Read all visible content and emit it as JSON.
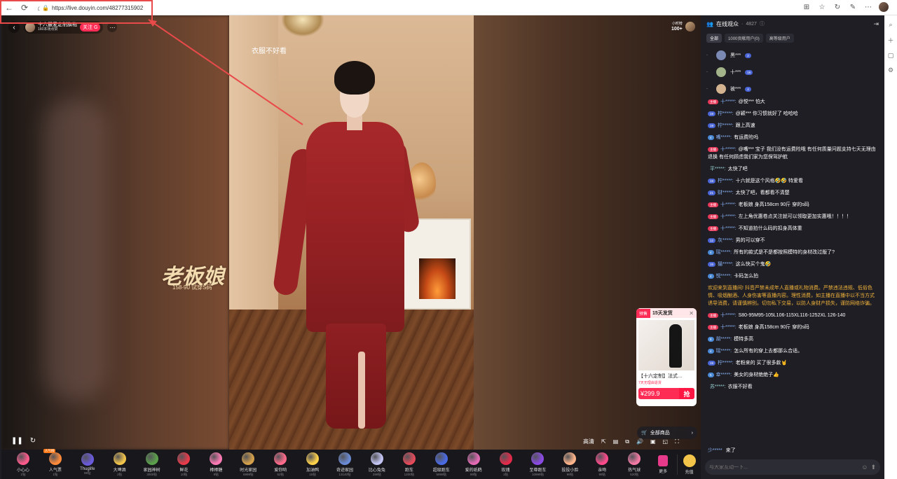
{
  "browser": {
    "url": "https://live.douyin.com/48277315902"
  },
  "video": {
    "caption": "衣服不好看",
    "watermark_main": "老板娘",
    "watermark_sub": "158-90 试穿S码"
  },
  "streamer": {
    "name": "十六最爱定制旗袍",
    "likes": "160本场点赞",
    "follow_label": "关注",
    "follow_badge": "G"
  },
  "rank": {
    "label": "小时榜",
    "value": "100+"
  },
  "product": {
    "tag": "预售",
    "ship": "15天发货",
    "title": "【十六定制】法式…",
    "sub": "7天无理由退货",
    "price": "¥299.9",
    "grab": "抢",
    "all_goods": "全部商品"
  },
  "controls": {
    "quality": "高清"
  },
  "gifts": [
    {
      "name": "小心心",
      "price": "1钻",
      "color": "#ff5a8c",
      "badge": ""
    },
    {
      "name": "人气票",
      "price": "1钻",
      "color": "#ff8a3a",
      "badge": "人气榜"
    },
    {
      "name": "Thuglife",
      "price": "99钻",
      "color": "#6a5adc",
      "badge": ""
    },
    {
      "name": "大啤酒",
      "price": "2钻",
      "color": "#f2c44a",
      "badge": ""
    },
    {
      "name": "家园神树",
      "price": "3000钻",
      "color": "#5aa04a",
      "badge": ""
    },
    {
      "name": "鲜花",
      "price": "10钻",
      "color": "#e83a4a",
      "badge": ""
    },
    {
      "name": "棒棒糖",
      "price": "9钻",
      "color": "#ff7ab4",
      "badge": ""
    },
    {
      "name": "时光家园",
      "price": "6999钻",
      "color": "#d4a04a",
      "badge": ""
    },
    {
      "name": "爱你哟",
      "price": "52钻",
      "color": "#ff6a8a",
      "badge": ""
    },
    {
      "name": "加油鸭",
      "price": "15钻",
      "color": "#ffd24a",
      "badge": ""
    },
    {
      "name": "奇迹家园",
      "price": "13140钻",
      "color": "#6a8ad4",
      "badge": ""
    },
    {
      "name": "比心兔兔",
      "price": "299钻",
      "color": "#c4c4f4",
      "badge": ""
    },
    {
      "name": "跑车",
      "price": "1200钻",
      "color": "#e44a5a",
      "badge": ""
    },
    {
      "name": "超级跑车",
      "price": "5999钻",
      "color": "#4a6ae4",
      "badge": ""
    },
    {
      "name": "爱的纸鹤",
      "price": "99钻",
      "color": "#e46ab4",
      "badge": ""
    },
    {
      "name": "玫瑰",
      "price": "1钻",
      "color": "#e42a4a",
      "badge": ""
    },
    {
      "name": "至尊跑车",
      "price": "10999钻",
      "color": "#8a4ae4",
      "badge": ""
    },
    {
      "name": "投投小脸",
      "price": "99钻",
      "color": "#ffb48a",
      "badge": ""
    },
    {
      "name": "亲吻",
      "price": "99钻",
      "color": "#ff4a8a",
      "badge": ""
    },
    {
      "name": "热气球",
      "price": "520钻",
      "color": "#f47aa4",
      "badge": ""
    }
  ],
  "gift_more": "更多",
  "gift_recharge": "充值",
  "panel": {
    "title": "在线观众",
    "count": "4827",
    "tabs": [
      "全部",
      "1000贡献用户(0)",
      "高等级用户"
    ]
  },
  "viewers": [
    {
      "rank": "-",
      "name": "黑***",
      "level": "2",
      "color": "#7a8ab4"
    },
    {
      "rank": "-",
      "name": "十***",
      "level": "16",
      "color": "#a4b48a"
    },
    {
      "rank": "-",
      "name": "被***",
      "level": "4",
      "color": "#d4b490"
    }
  ],
  "chat": [
    {
      "badge": "主播",
      "badge_type": "host",
      "user": "十*****:",
      "text": "@悦*** 怕大"
    },
    {
      "badge": "19",
      "badge_type": "lvl",
      "user": "柠*****:",
      "text": "@颖*** 你习惯就好了 哈哈哈"
    },
    {
      "badge": "19",
      "badge_type": "lvl",
      "user": "柠*****:",
      "text": "跟上高速"
    },
    {
      "badge": "4",
      "badge_type": "gold",
      "user": "嘴*****:",
      "text": "有运费险吗"
    },
    {
      "badge": "主播",
      "badge_type": "host",
      "user": "十*****:",
      "text": "@嘴*** 宝子 我们没有运费险哦 有任何质量问题支持七天无理由退换 有任何顾虑我们家为您保驾护航"
    },
    {
      "badge": "",
      "badge_type": "none",
      "user": "平*****:",
      "text": "太快了吧"
    },
    {
      "badge": "19",
      "badge_type": "lvl",
      "user": "柠*****:",
      "text": "十六就是这个风格🤣🤣 特爱看"
    },
    {
      "badge": "21",
      "badge_type": "lvl",
      "user": "财*****:",
      "text": "太快了吧，看都看不清楚"
    },
    {
      "badge": "主播",
      "badge_type": "host",
      "user": "十*****:",
      "text": "老板娘 身高158cm 90斤 穿的s码"
    },
    {
      "badge": "主播",
      "badge_type": "host",
      "user": "十*****:",
      "text": "左上角优惠卷点关注就可以领取更加实惠哦！！！！"
    },
    {
      "badge": "主播",
      "badge_type": "host",
      "user": "十*****:",
      "text": "不知道拍什么码的扣身高体重"
    },
    {
      "badge": "12",
      "badge_type": "lvl",
      "user": "灰*****:",
      "text": "男的可以穿不"
    },
    {
      "badge": "4",
      "badge_type": "gold",
      "user": "瑶*****:",
      "text": "所有的款式是不是都按照模特的身材改过版了?"
    },
    {
      "badge": "15",
      "badge_type": "lvl",
      "user": "猫*****:",
      "text": "这么快买个鬼🤣"
    },
    {
      "badge": "4",
      "badge_type": "gold",
      "user": "悦*****:",
      "text": "卡码怎么拍"
    },
    {
      "badge": "",
      "badge_type": "notice",
      "user": "",
      "text": "欢迎来到直播间! 抖音严禁未成年人直播或礼物消费。严禁违法违规、低俗色情、吸烟酗酒、人身伤害等直播内容。理性消费，如主播在直播中以不当方式诱导消费，请谨慎辨别。切勿私下交易，以防人身财产损失，谨防网络诈骗。"
    },
    {
      "badge": "主播",
      "badge_type": "host",
      "user": "十*****:",
      "text": "S80-95M95-105L106-115XL116-1252XL 126-140"
    },
    {
      "badge": "主播",
      "badge_type": "host",
      "user": "十*****:",
      "text": "老板娘 身高158cm 90斤 穿的s码"
    },
    {
      "badge": "8",
      "badge_type": "gold",
      "user": "胡*****:",
      "text": "模特多高"
    },
    {
      "badge": "4",
      "badge_type": "gold",
      "user": "瑶*****:",
      "text": "怎么所有的穿上去都那么合适。"
    },
    {
      "badge": "19",
      "badge_type": "lvl",
      "user": "柠*****:",
      "text": "老粉来的 买了很多款🤘"
    },
    {
      "badge": "5",
      "badge_type": "gold",
      "user": "幸*****:",
      "text": "美女的身材绝绝子👍"
    },
    {
      "badge": "",
      "badge_type": "none",
      "user": "苏*****:",
      "text": "衣服不好看"
    }
  ],
  "joined": {
    "user": "少*****",
    "text": "来了"
  },
  "input": {
    "placeholder": "与大家互动一下..."
  }
}
